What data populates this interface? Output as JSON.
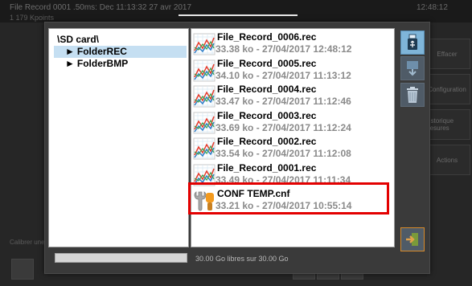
{
  "background": {
    "title": "File Record 0001 .50ms: Dec 11:13:32 27 avr 2017",
    "subtitle": "1 179 Kpoints",
    "time": "12:48:12",
    "right_buttons": [
      "Effacer",
      "Configuration",
      "Historique mesures",
      "Actions"
    ],
    "left_label": "Calibrer une"
  },
  "dialog": {
    "tree": {
      "root": "\\SD card\\",
      "folders": [
        {
          "label": "FolderREC",
          "selected": true
        },
        {
          "label": "FolderBMP",
          "selected": false
        }
      ]
    },
    "files": [
      {
        "name": "File_Record_0006.rec",
        "meta": "33.38 ko - 27/04/2017 12:48:12",
        "icon": "graph-file-icon"
      },
      {
        "name": "File_Record_0005.rec",
        "meta": "34.10 ko - 27/04/2017 11:13:12",
        "icon": "graph-file-icon"
      },
      {
        "name": "File_Record_0004.rec",
        "meta": "33.47 ko - 27/04/2017 11:12:46",
        "icon": "graph-file-icon"
      },
      {
        "name": "File_Record_0003.rec",
        "meta": "33.69 ko - 27/04/2017 11:12:24",
        "icon": "graph-file-icon"
      },
      {
        "name": "File_Record_0002.rec",
        "meta": "33.54 ko - 27/04/2017 11:12:08",
        "icon": "graph-file-icon"
      },
      {
        "name": "File_Record_0001.rec",
        "meta": "33.49 ko - 27/04/2017 11:11:34",
        "icon": "graph-file-icon"
      },
      {
        "name": "CONF TEMP.cnf",
        "meta": "33.21 ko - 27/04/2017 10:55:14",
        "icon": "config-file-icon",
        "highlighted": true
      }
    ],
    "toolbar": {
      "usb": "usb-icon",
      "transfer": "transfer-icon",
      "delete": "trash-icon",
      "exit": "exit-icon"
    },
    "storage": {
      "free_text": "30.00 Go libres sur 30.00 Go",
      "used_fraction": 0.0
    }
  },
  "colors": {
    "highlight_border": "#e30000",
    "selection": "#c5dff2",
    "usb_button": "#7fb5d9",
    "exit_accent": "#d88a2a"
  }
}
